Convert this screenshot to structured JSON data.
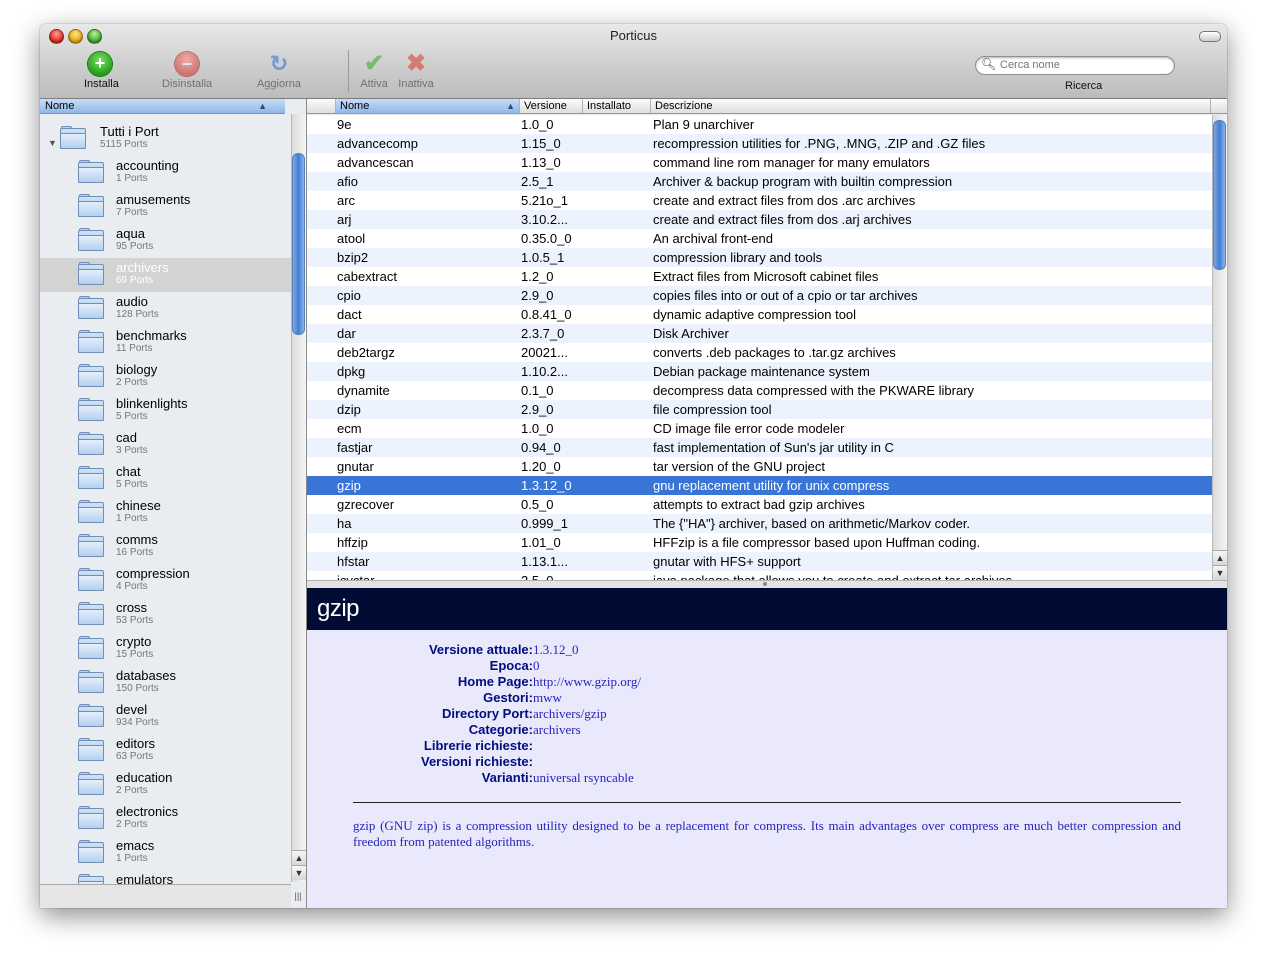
{
  "window": {
    "title": "Porticus"
  },
  "toolbar": {
    "install": "Installa",
    "uninstall": "Disinstalla",
    "update": "Aggiorna",
    "activate": "Attiva",
    "deactivate": "Inattiva",
    "search_placeholder": "Cerca nome",
    "search_label": "Ricerca"
  },
  "sidebar": {
    "header": "Nome",
    "root": {
      "name": "Tutti i Port",
      "count": "5115 Ports"
    },
    "items": [
      {
        "name": "accounting",
        "count": "1 Ports"
      },
      {
        "name": "amusements",
        "count": "7 Ports"
      },
      {
        "name": "aqua",
        "count": "95 Ports"
      },
      {
        "name": "archivers",
        "count": "69 Ports"
      },
      {
        "name": "audio",
        "count": "128 Ports"
      },
      {
        "name": "benchmarks",
        "count": "11 Ports"
      },
      {
        "name": "biology",
        "count": "2 Ports"
      },
      {
        "name": "blinkenlights",
        "count": "5 Ports"
      },
      {
        "name": "cad",
        "count": "3 Ports"
      },
      {
        "name": "chat",
        "count": "5 Ports"
      },
      {
        "name": "chinese",
        "count": "1 Ports"
      },
      {
        "name": "comms",
        "count": "16 Ports"
      },
      {
        "name": "compression",
        "count": "4 Ports"
      },
      {
        "name": "cross",
        "count": "53 Ports"
      },
      {
        "name": "crypto",
        "count": "15 Ports"
      },
      {
        "name": "databases",
        "count": "150 Ports"
      },
      {
        "name": "devel",
        "count": "934 Ports"
      },
      {
        "name": "editors",
        "count": "63 Ports"
      },
      {
        "name": "education",
        "count": "2 Ports"
      },
      {
        "name": "electronics",
        "count": "2 Ports"
      },
      {
        "name": "emacs",
        "count": "1 Ports"
      },
      {
        "name": "emulators",
        "count": ""
      }
    ],
    "selected": "archivers"
  },
  "table": {
    "headers": {
      "name": "Nome",
      "version": "Versione",
      "installed": "Installato",
      "description": "Descrizione"
    },
    "rows": [
      {
        "name": "9e",
        "version": "1.0_0",
        "installed": "",
        "description": "Plan 9 unarchiver"
      },
      {
        "name": "advancecomp",
        "version": "1.15_0",
        "installed": "",
        "description": "recompression utilities for .PNG, .MNG, .ZIP and .GZ files"
      },
      {
        "name": "advancescan",
        "version": "1.13_0",
        "installed": "",
        "description": "command line rom manager for many emulators"
      },
      {
        "name": "afio",
        "version": "2.5_1",
        "installed": "",
        "description": "Archiver & backup program with builtin compression"
      },
      {
        "name": "arc",
        "version": "5.21o_1",
        "installed": "",
        "description": "create and extract files from dos .arc archives"
      },
      {
        "name": "arj",
        "version": "3.10.2...",
        "installed": "",
        "description": "create and extract files from dos .arj archives"
      },
      {
        "name": "atool",
        "version": "0.35.0_0",
        "installed": "",
        "description": "An archival front-end"
      },
      {
        "name": "bzip2",
        "version": "1.0.5_1",
        "installed": "",
        "description": "compression library and tools"
      },
      {
        "name": "cabextract",
        "version": "1.2_0",
        "installed": "",
        "description": "Extract files from Microsoft cabinet files"
      },
      {
        "name": "cpio",
        "version": "2.9_0",
        "installed": "",
        "description": "copies files into or out of a cpio or tar archives"
      },
      {
        "name": "dact",
        "version": "0.8.41_0",
        "installed": "",
        "description": "dynamic adaptive compression tool"
      },
      {
        "name": "dar",
        "version": "2.3.7_0",
        "installed": "",
        "description": "Disk Archiver"
      },
      {
        "name": "deb2targz",
        "version": "20021...",
        "installed": "",
        "description": "converts .deb packages to .tar.gz archives"
      },
      {
        "name": "dpkg",
        "version": "1.10.2...",
        "installed": "",
        "description": "Debian package maintenance system"
      },
      {
        "name": "dynamite",
        "version": "0.1_0",
        "installed": "",
        "description": "decompress data compressed with the PKWARE library"
      },
      {
        "name": "dzip",
        "version": "2.9_0",
        "installed": "",
        "description": "file compression tool"
      },
      {
        "name": "ecm",
        "version": "1.0_0",
        "installed": "",
        "description": "CD image file error code modeler"
      },
      {
        "name": "fastjar",
        "version": "0.94_0",
        "installed": "",
        "description": "fast implementation of Sun's jar utility in C"
      },
      {
        "name": "gnutar",
        "version": "1.20_0",
        "installed": "",
        "description": "tar version of the GNU project"
      },
      {
        "name": "gzip",
        "version": "1.3.12_0",
        "installed": "",
        "description": "gnu replacement utility for unix compress"
      },
      {
        "name": "gzrecover",
        "version": "0.5_0",
        "installed": "",
        "description": "attempts to extract bad gzip archives"
      },
      {
        "name": "ha",
        "version": "0.999_1",
        "installed": "",
        "description": "The {\"HA\"} archiver, based on arithmetic/Markov coder."
      },
      {
        "name": "hffzip",
        "version": "1.01_0",
        "installed": "",
        "description": "HFFzip is a file compressor based upon Huffman coding."
      },
      {
        "name": "hfstar",
        "version": "1.13.1...",
        "installed": "",
        "description": "gnutar with HFS+ support"
      },
      {
        "name": "jcyctar",
        "version": "2.5_0",
        "installed": "",
        "description": "java package that allows you to create and extract tar archives"
      }
    ],
    "selected": "gzip"
  },
  "detail": {
    "title": "gzip",
    "props": [
      {
        "key": "Versione attuale:",
        "value": "1.3.12_0"
      },
      {
        "key": "Epoca:",
        "value": "0"
      },
      {
        "key": "Home Page:",
        "value": "http://www.gzip.org/"
      },
      {
        "key": "Gestori:",
        "value": "mww"
      },
      {
        "key": "Directory Port:",
        "value": "archivers/gzip"
      },
      {
        "key": "Categorie:",
        "value": "archivers"
      },
      {
        "key": "Librerie richieste:",
        "value": ""
      },
      {
        "key": "Versioni richieste:",
        "value": ""
      },
      {
        "key": "Varianti:",
        "value": "universal rsyncable"
      }
    ],
    "description": "gzip (GNU zip) is a compression utility designed to be a replacement for compress. Its main advantages over compress are much better compression and freedom from patented algorithms."
  }
}
